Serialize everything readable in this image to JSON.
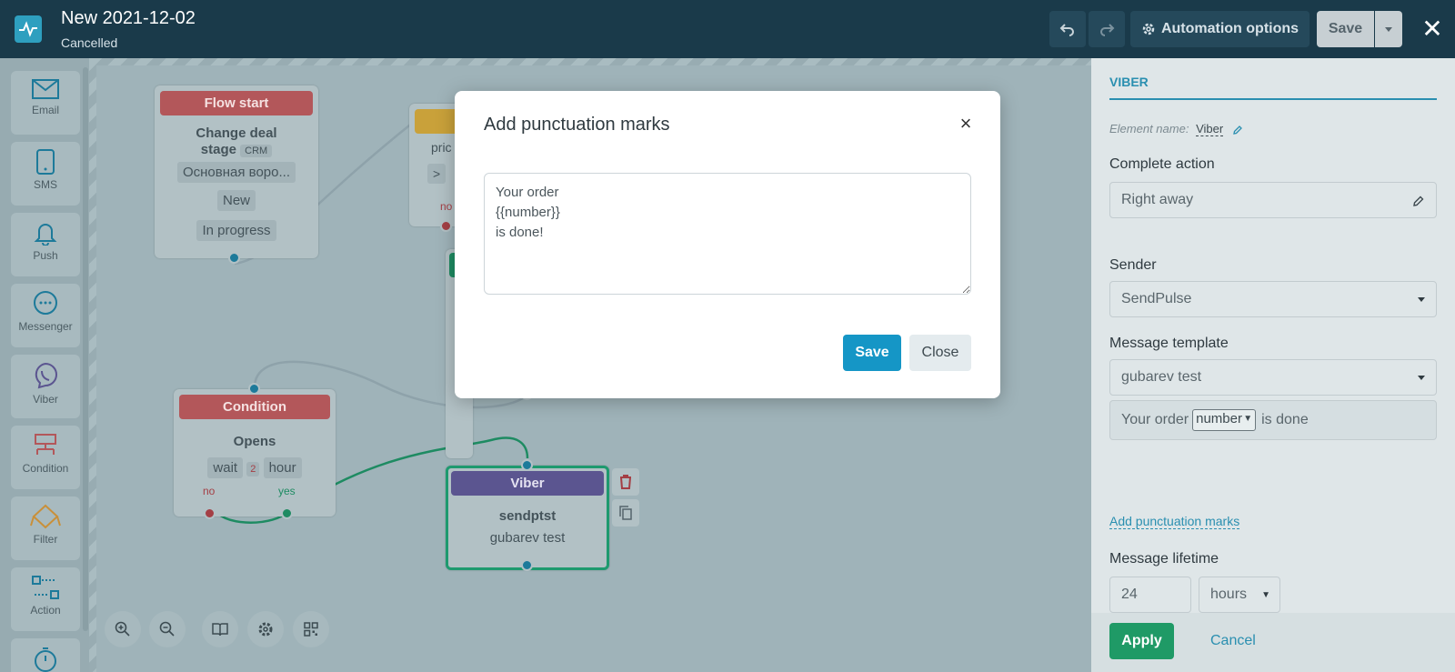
{
  "header": {
    "title": "New 2021-12-02",
    "status": "Cancelled",
    "automation_options_label": "Automation options",
    "save_label": "Save"
  },
  "toolbar": {
    "items": [
      {
        "label": "Email",
        "icon": "email-icon"
      },
      {
        "label": "SMS",
        "icon": "sms-icon"
      },
      {
        "label": "Push",
        "icon": "bell-icon"
      },
      {
        "label": "Messenger",
        "icon": "chat-icon"
      },
      {
        "label": "Viber",
        "icon": "viber-icon"
      },
      {
        "label": "Condition",
        "icon": "condition-icon"
      },
      {
        "label": "Filter",
        "icon": "filter-icon"
      },
      {
        "label": "Action",
        "icon": "action-icon"
      }
    ]
  },
  "nodes": {
    "flow_start": {
      "header": "Flow start",
      "line1": "Change deal",
      "line2": "stage",
      "badge": "CRM",
      "pipeline": "Основная воро...",
      "from": "New",
      "to": "In progress"
    },
    "hidden_node": {
      "text": "pric",
      "arrow": ">",
      "no_label": "no"
    },
    "condition": {
      "header": "Condition",
      "title": "Opens",
      "wait": "wait",
      "count": "2",
      "unit": "hour",
      "no_label": "no",
      "yes_label": "yes"
    },
    "viber": {
      "header": "Viber",
      "sender": "sendptst",
      "template": "gubarev test"
    }
  },
  "modal": {
    "title": "Add punctuation marks",
    "text": "Your order\n{{number}}\nis done!",
    "save_label": "Save",
    "close_label": "Close"
  },
  "panel": {
    "tab": "VIBER",
    "element_name_label": "Element name:",
    "element_name_value": "Viber",
    "complete_action_label": "Complete action",
    "complete_action_value": "Right away",
    "sender_label": "Sender",
    "sender_value": "SendPulse",
    "template_label": "Message template",
    "template_value": "gubarev test",
    "preview_prefix": "Your order",
    "preview_select": "number",
    "preview_suffix": "is done",
    "add_punctuation_link": "Add punctuation marks",
    "lifetime_label": "Message lifetime",
    "lifetime_value": "24",
    "lifetime_unit": "hours",
    "apply_label": "Apply",
    "cancel_label": "Cancel"
  },
  "colors": {
    "header_bg": "#1a3a4a",
    "accent": "#1596c6",
    "apply_green": "#1f9a66",
    "viber_purple": "#5b5590",
    "red_header": "#b3575a"
  }
}
